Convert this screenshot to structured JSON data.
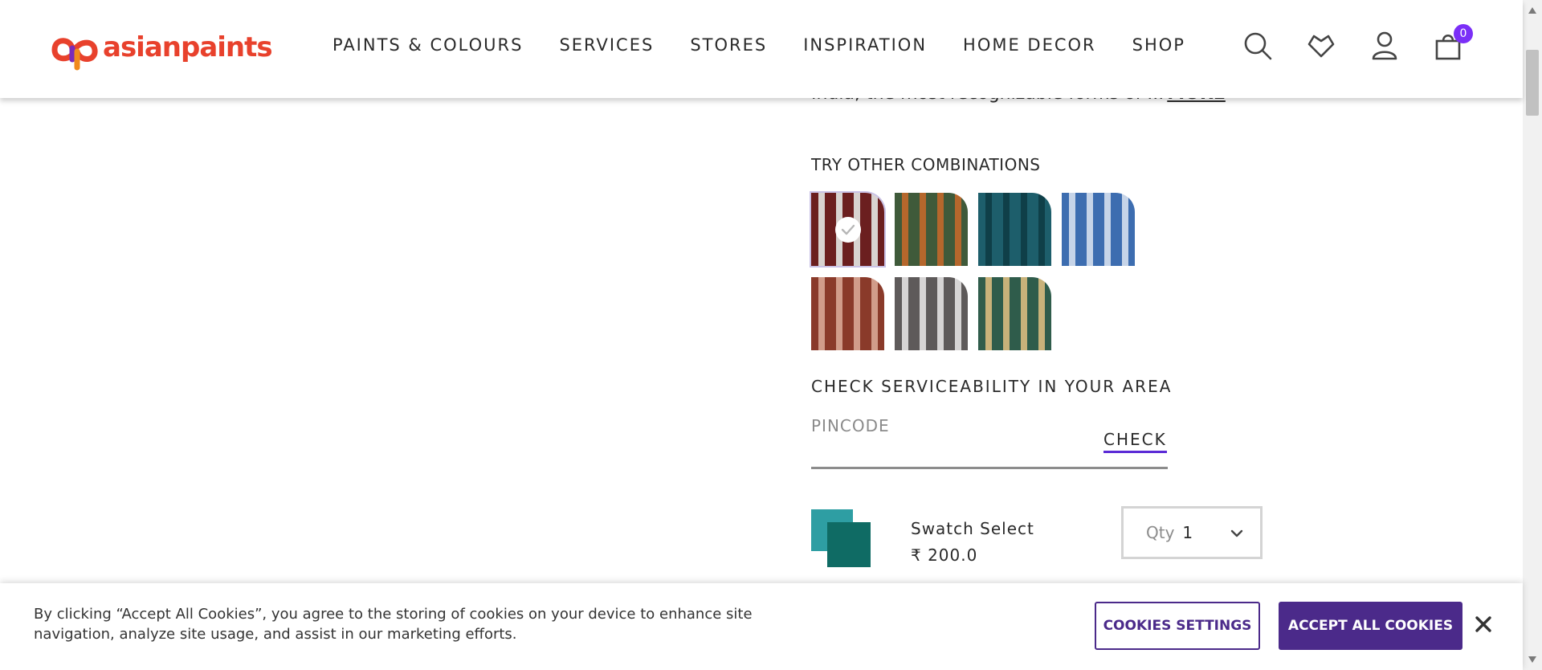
{
  "brand": {
    "name": "asianpaints",
    "color": "#e8412c"
  },
  "nav": {
    "items": [
      {
        "label": "PAINTS & COLOURS"
      },
      {
        "label": "SERVICES"
      },
      {
        "label": "STORES"
      },
      {
        "label": "INSPIRATION"
      },
      {
        "label": "HOME DECOR"
      },
      {
        "label": "SHOP"
      }
    ]
  },
  "header_icons": {
    "search": "search-icon",
    "wishlist": "heart-icon",
    "account": "user-icon",
    "cart": "cart-icon",
    "cart_count": "0",
    "badge_color": "#7b2ff7"
  },
  "product": {
    "description_fragment": "India, the most recognizable forms of ...",
    "more_label": "MORE",
    "combinations_heading": "TRY OTHER COMBINATIONS",
    "combinations": [
      {
        "name": "maroon-white",
        "colors": [
          "#6b1f1f",
          "#d8d3d0"
        ],
        "selected": true
      },
      {
        "name": "green-rust",
        "colors": [
          "#3f5a3a",
          "#b5672c"
        ],
        "selected": false
      },
      {
        "name": "teal-dark",
        "colors": [
          "#1d5e6b",
          "#0f3f48"
        ],
        "selected": false
      },
      {
        "name": "blue-white",
        "colors": [
          "#3d6db0",
          "#c6d4e8"
        ],
        "selected": false
      },
      {
        "name": "rust-pink",
        "colors": [
          "#8a3a2a",
          "#d19c8a"
        ],
        "selected": false
      },
      {
        "name": "grey-white",
        "colors": [
          "#5e5a5a",
          "#d6d4d4"
        ],
        "selected": false
      },
      {
        "name": "green-sand",
        "colors": [
          "#2f5c4b",
          "#c8b27a"
        ],
        "selected": false
      }
    ],
    "serviceability_heading": "CHECK SERVICEABILITY IN YOUR AREA",
    "pincode_placeholder": "PINCODE",
    "check_label": "CHECK",
    "swatch_title": "Swatch Select",
    "swatch_price": "₹ 200.0",
    "qty_label": "Qty",
    "qty_value": "1"
  },
  "cookie": {
    "text": "By clicking “Accept All Cookies”, you agree to the storing of cookies on your device to enhance site navigation, analyze site usage, and assist in our marketing efforts.",
    "settings_label": "COOKIES SETTINGS",
    "accept_label": "ACCEPT ALL COOKIES",
    "accent_color": "#4b2a8a"
  }
}
